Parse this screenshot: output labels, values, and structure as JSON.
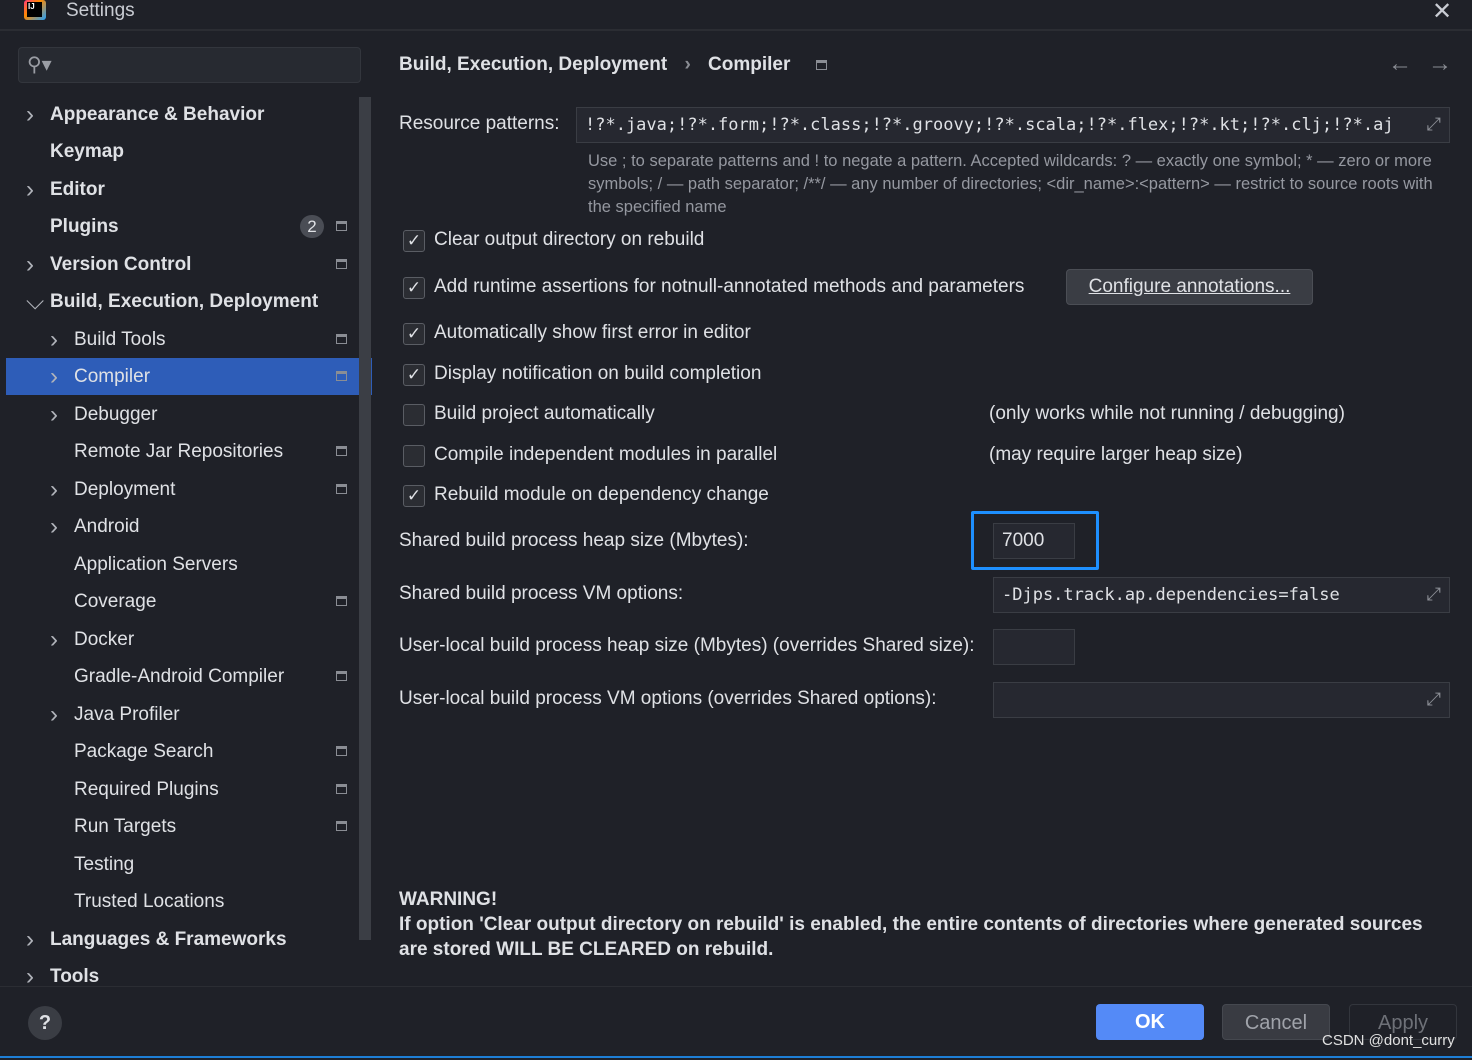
{
  "window": {
    "title": "Settings",
    "logo_text": "IJ",
    "close": "✕"
  },
  "search": {
    "icon": "search-icon",
    "placeholder": ""
  },
  "tree": [
    {
      "label": "Appearance & Behavior",
      "level": 0,
      "chevron": "right",
      "bold": true
    },
    {
      "label": "Keymap",
      "level": 0,
      "bold": true
    },
    {
      "label": "Editor",
      "level": 0,
      "chevron": "right",
      "bold": true
    },
    {
      "label": "Plugins",
      "level": 0,
      "bold": true,
      "badge": "2",
      "page_icon": true
    },
    {
      "label": "Version Control",
      "level": 0,
      "chevron": "right",
      "bold": true,
      "page_icon": true
    },
    {
      "label": "Build, Execution, Deployment",
      "level": 0,
      "chevron": "down",
      "bold": true
    },
    {
      "label": "Build Tools",
      "level": 1,
      "chevron": "right",
      "page_icon": true
    },
    {
      "label": "Compiler",
      "level": 1,
      "chevron": "right",
      "page_icon": true,
      "selected": true
    },
    {
      "label": "Debugger",
      "level": 1,
      "chevron": "right"
    },
    {
      "label": "Remote Jar Repositories",
      "level": 1,
      "page_icon": true
    },
    {
      "label": "Deployment",
      "level": 1,
      "chevron": "right",
      "page_icon": true
    },
    {
      "label": "Android",
      "level": 1,
      "chevron": "right"
    },
    {
      "label": "Application Servers",
      "level": 1
    },
    {
      "label": "Coverage",
      "level": 1,
      "page_icon": true
    },
    {
      "label": "Docker",
      "level": 1,
      "chevron": "right"
    },
    {
      "label": "Gradle-Android Compiler",
      "level": 1,
      "page_icon": true
    },
    {
      "label": "Java Profiler",
      "level": 1,
      "chevron": "right"
    },
    {
      "label": "Package Search",
      "level": 1,
      "page_icon": true
    },
    {
      "label": "Required Plugins",
      "level": 1,
      "page_icon": true
    },
    {
      "label": "Run Targets",
      "level": 1,
      "page_icon": true
    },
    {
      "label": "Testing",
      "level": 1
    },
    {
      "label": "Trusted Locations",
      "level": 1
    },
    {
      "label": "Languages & Frameworks",
      "level": 0,
      "chevron": "right",
      "bold": true
    },
    {
      "label": "Tools",
      "level": 0,
      "chevron": "right",
      "bold": true
    }
  ],
  "breadcrumb": {
    "parent": "Build, Execution, Deployment",
    "sep": "›",
    "current": "Compiler",
    "back": "←",
    "forward": "→"
  },
  "resource_patterns": {
    "label": "Resource patterns:",
    "value": "!?*.java;!?*.form;!?*.class;!?*.groovy;!?*.scala;!?*.flex;!?*.kt;!?*.clj;!?*.aj",
    "hint": "Use ; to separate patterns and ! to negate a pattern. Accepted wildcards: ? — exactly one symbol; * — zero or more symbols; / — path separator; /**/ — any number of directories; <dir_name>:<pattern> — restrict to source roots with the specified name"
  },
  "options": [
    {
      "label": "Clear output directory on rebuild",
      "checked": true
    },
    {
      "label": "Add runtime assertions for notnull-annotated methods and parameters",
      "checked": true
    },
    {
      "label": "Automatically show first error in editor",
      "checked": true
    },
    {
      "label": "Display notification on build completion",
      "checked": true
    },
    {
      "label": "Build project automatically",
      "checked": false,
      "note": "(only works while not running / debugging)"
    },
    {
      "label": "Compile independent modules in parallel",
      "checked": false,
      "note": "(may require larger heap size)"
    },
    {
      "label": "Rebuild module on dependency change",
      "checked": true
    }
  ],
  "configure_annotations": "Configure annotations...",
  "heap": {
    "label": "Shared build process heap size (Mbytes):",
    "value": "7000"
  },
  "vm": {
    "label": "Shared build process VM options:",
    "value": "-Djps.track.ap.dependencies=false"
  },
  "user_heap": {
    "label": "User-local build process heap size (Mbytes) (overrides Shared size):",
    "value": ""
  },
  "user_vm": {
    "label": "User-local build process VM options (overrides Shared options):",
    "value": ""
  },
  "warning": {
    "title": "WARNING!",
    "text": "If option 'Clear output directory on rebuild' is enabled, the entire contents of directories where generated sources are stored WILL BE CLEARED on rebuild."
  },
  "footer": {
    "help": "?",
    "ok": "OK",
    "cancel": "Cancel",
    "apply": "Apply"
  },
  "watermark": "CSDN @dont_curry",
  "colors": {
    "accent": "#548af7",
    "selection": "#2e5db8",
    "highlight_box": "#1e90ff"
  }
}
